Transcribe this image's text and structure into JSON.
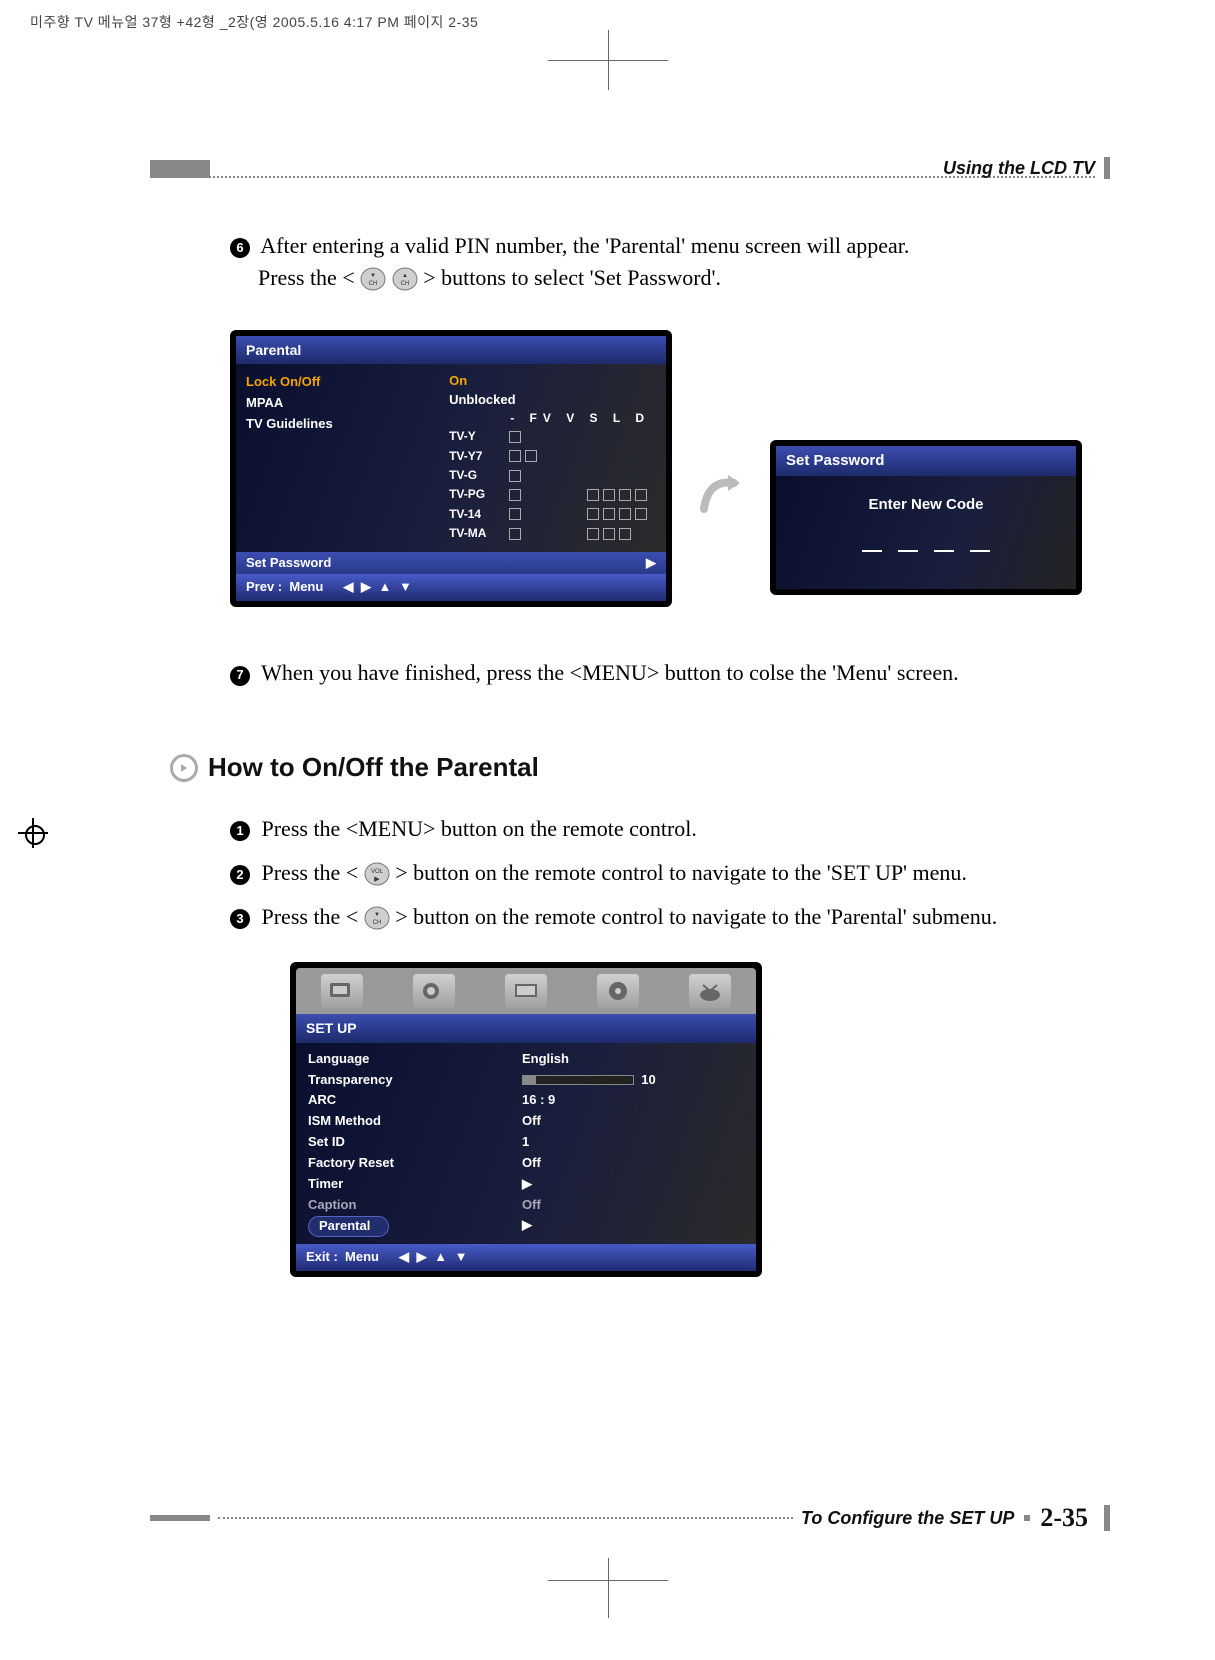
{
  "meta_line": "미주향 TV 메뉴얼 37형 +42형 _2장(영   2005.5.16 4:17 PM 페이지 2-35",
  "header": {
    "right": "Using the LCD TV"
  },
  "step6": {
    "num": "6",
    "text_a": "After entering a valid PIN number, the 'Parental' menu screen will appear.",
    "text_b_pre": "Press the <",
    "text_b_post": "> buttons to select 'Set Password'."
  },
  "parental_panel": {
    "title": "Parental",
    "left": {
      "lock": "Lock On/Off",
      "mpaa": "MPAA",
      "tvg": "TV Guidelines"
    },
    "right": {
      "on": "On",
      "unblocked": "Unblocked",
      "head": "- FV V S L D",
      "rows": [
        "TV-Y",
        "TV-Y7",
        "TV-G",
        "TV-PG",
        "TV-14",
        "TV-MA"
      ]
    },
    "set_password": "Set Password",
    "footer": {
      "prev": "Prev :",
      "menu": "Menu",
      "arrows": "◀ ▶ ▲ ▼"
    }
  },
  "setpw_panel": {
    "title": "Set Password",
    "enter": "Enter New Code"
  },
  "step7": {
    "num": "7",
    "text": "When you have finished, press the <MENU> button to colse the 'Menu' screen."
  },
  "section": {
    "title": "How to On/Off the Parental"
  },
  "step1": {
    "num": "1",
    "text": "Press the <MENU> button on the remote control."
  },
  "step2": {
    "num": "2",
    "text_pre": "Press the <",
    "text_post": "> button on the remote control to navigate to the 'SET UP' menu."
  },
  "step3": {
    "num": "3",
    "text_pre": "Press the <",
    "text_post": "> button on the remote control to navigate to the 'Parental' submenu."
  },
  "setup_panel": {
    "title": "SET UP",
    "left": [
      "Language",
      "Transparency",
      "ARC",
      "ISM Method",
      "Set ID",
      "Factory Reset",
      "Timer",
      "Caption",
      "Parental"
    ],
    "right": {
      "language": "English",
      "transparency_val": "10",
      "arc": "16 : 9",
      "ism": "Off",
      "setid": "1",
      "factory": "Off",
      "timer": "▶",
      "caption": "Off",
      "parental": "▶"
    },
    "footer": {
      "exit": "Exit :",
      "menu": "Menu",
      "arrows": "◀ ▶ ▲ ▼"
    }
  },
  "footer": {
    "label": "To Configure the SET UP",
    "page": "2-35"
  }
}
